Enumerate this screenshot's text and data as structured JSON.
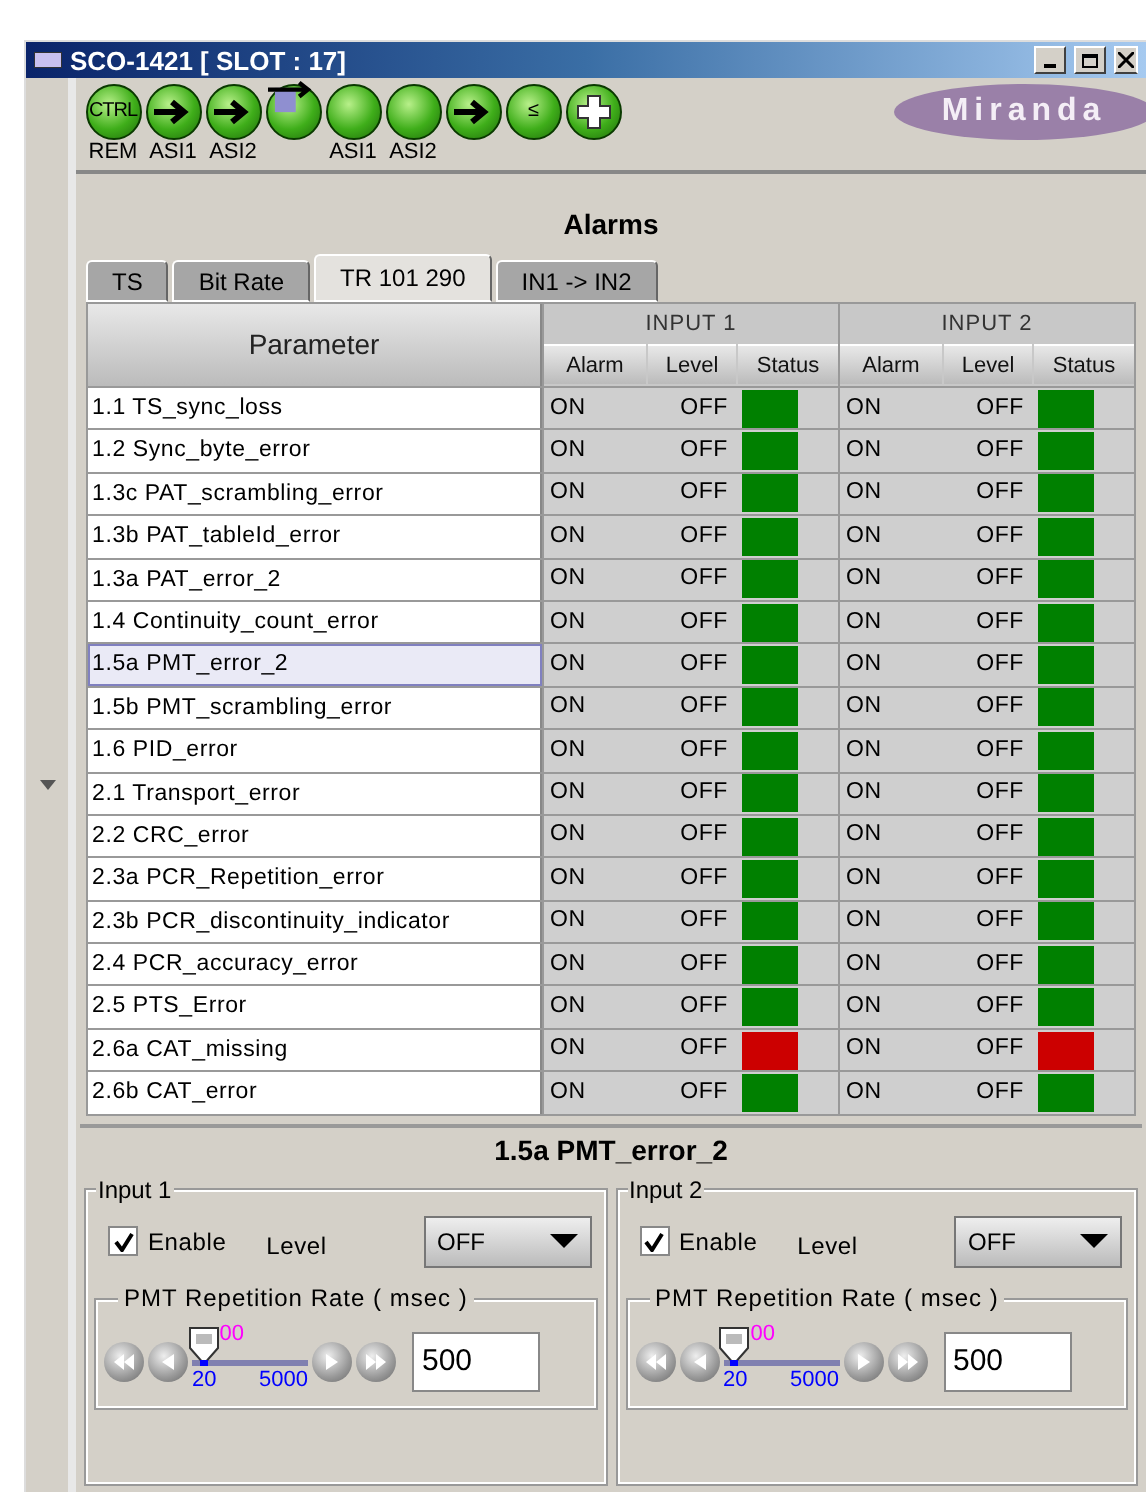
{
  "window": {
    "title": "SCO-1421 [ SLOT : 17]"
  },
  "toolbar": {
    "icons": [
      {
        "kind": "text",
        "text": "CTRL",
        "label": "REM"
      },
      {
        "kind": "arrow",
        "label": "ASI1"
      },
      {
        "kind": "arrow",
        "label": "ASI2"
      },
      {
        "kind": "switch"
      },
      {
        "kind": "plain",
        "label": "ASI1"
      },
      {
        "kind": "plain",
        "label": "ASI2"
      },
      {
        "kind": "arrow"
      },
      {
        "kind": "text",
        "text": "≤"
      },
      {
        "kind": "plus"
      }
    ],
    "logo": "Miranda"
  },
  "heading": "Alarms",
  "tabs": [
    {
      "label": "TS",
      "selected": false
    },
    {
      "label": "Bit Rate",
      "selected": false
    },
    {
      "label": "TR 101 290",
      "selected": true
    },
    {
      "label": "IN1 -> IN2",
      "selected": false
    }
  ],
  "table": {
    "parameter_header": "Parameter",
    "groups": [
      {
        "title": "INPUT 1",
        "columns": [
          "Alarm",
          "Level",
          "Status"
        ]
      },
      {
        "title": "INPUT 2",
        "columns": [
          "Alarm",
          "Level",
          "Status"
        ]
      }
    ],
    "rows": [
      {
        "parameter": "1.1 TS_sync_loss",
        "selected": false,
        "inputs": [
          {
            "alarm": "ON",
            "level": "OFF",
            "color": "#008000"
          },
          {
            "alarm": "ON",
            "level": "OFF",
            "color": "#008000"
          }
        ]
      },
      {
        "parameter": "1.2 Sync_byte_error",
        "selected": false,
        "inputs": [
          {
            "alarm": "ON",
            "level": "OFF",
            "color": "#008000"
          },
          {
            "alarm": "ON",
            "level": "OFF",
            "color": "#008000"
          }
        ]
      },
      {
        "parameter": "1.3c PAT_scrambling_error",
        "selected": false,
        "inputs": [
          {
            "alarm": "ON",
            "level": "OFF",
            "color": "#008000"
          },
          {
            "alarm": "ON",
            "level": "OFF",
            "color": "#008000"
          }
        ]
      },
      {
        "parameter": "1.3b PAT_tableId_error",
        "selected": false,
        "inputs": [
          {
            "alarm": "ON",
            "level": "OFF",
            "color": "#008000"
          },
          {
            "alarm": "ON",
            "level": "OFF",
            "color": "#008000"
          }
        ]
      },
      {
        "parameter": "1.3a PAT_error_2",
        "selected": false,
        "inputs": [
          {
            "alarm": "ON",
            "level": "OFF",
            "color": "#008000"
          },
          {
            "alarm": "ON",
            "level": "OFF",
            "color": "#008000"
          }
        ]
      },
      {
        "parameter": "1.4 Continuity_count_error",
        "selected": false,
        "inputs": [
          {
            "alarm": "ON",
            "level": "OFF",
            "color": "#008000"
          },
          {
            "alarm": "ON",
            "level": "OFF",
            "color": "#008000"
          }
        ]
      },
      {
        "parameter": "1.5a PMT_error_2",
        "selected": true,
        "inputs": [
          {
            "alarm": "ON",
            "level": "OFF",
            "color": "#008000"
          },
          {
            "alarm": "ON",
            "level": "OFF",
            "color": "#008000"
          }
        ]
      },
      {
        "parameter": "1.5b PMT_scrambling_error",
        "selected": false,
        "inputs": [
          {
            "alarm": "ON",
            "level": "OFF",
            "color": "#008000"
          },
          {
            "alarm": "ON",
            "level": "OFF",
            "color": "#008000"
          }
        ]
      },
      {
        "parameter": "1.6 PID_error",
        "selected": false,
        "inputs": [
          {
            "alarm": "ON",
            "level": "OFF",
            "color": "#008000"
          },
          {
            "alarm": "ON",
            "level": "OFF",
            "color": "#008000"
          }
        ]
      },
      {
        "parameter": "2.1 Transport_error",
        "selected": false,
        "inputs": [
          {
            "alarm": "ON",
            "level": "OFF",
            "color": "#008000"
          },
          {
            "alarm": "ON",
            "level": "OFF",
            "color": "#008000"
          }
        ]
      },
      {
        "parameter": "2.2 CRC_error",
        "selected": false,
        "inputs": [
          {
            "alarm": "ON",
            "level": "OFF",
            "color": "#008000"
          },
          {
            "alarm": "ON",
            "level": "OFF",
            "color": "#008000"
          }
        ]
      },
      {
        "parameter": "2.3a PCR_Repetition_error",
        "selected": false,
        "inputs": [
          {
            "alarm": "ON",
            "level": "OFF",
            "color": "#008000"
          },
          {
            "alarm": "ON",
            "level": "OFF",
            "color": "#008000"
          }
        ]
      },
      {
        "parameter": "2.3b PCR_discontinuity_indicator",
        "selected": false,
        "inputs": [
          {
            "alarm": "ON",
            "level": "OFF",
            "color": "#008000"
          },
          {
            "alarm": "ON",
            "level": "OFF",
            "color": "#008000"
          }
        ]
      },
      {
        "parameter": "2.4 PCR_accuracy_error",
        "selected": false,
        "inputs": [
          {
            "alarm": "ON",
            "level": "OFF",
            "color": "#008000"
          },
          {
            "alarm": "ON",
            "level": "OFF",
            "color": "#008000"
          }
        ]
      },
      {
        "parameter": "2.5 PTS_Error",
        "selected": false,
        "inputs": [
          {
            "alarm": "ON",
            "level": "OFF",
            "color": "#008000"
          },
          {
            "alarm": "ON",
            "level": "OFF",
            "color": "#008000"
          }
        ]
      },
      {
        "parameter": "2.6a CAT_missing",
        "selected": false,
        "inputs": [
          {
            "alarm": "ON",
            "level": "OFF",
            "color": "#cc0000"
          },
          {
            "alarm": "ON",
            "level": "OFF",
            "color": "#cc0000"
          }
        ]
      },
      {
        "parameter": "2.6b CAT_error",
        "selected": false,
        "inputs": [
          {
            "alarm": "ON",
            "level": "OFF",
            "color": "#008000"
          },
          {
            "alarm": "ON",
            "level": "OFF",
            "color": "#008000"
          }
        ]
      }
    ]
  },
  "detail": {
    "title": "1.5a PMT_error_2",
    "panels": [
      {
        "title": "Input 1",
        "enable": {
          "label": "Enable",
          "checked": true
        },
        "level_label": "Level",
        "level_value": "OFF",
        "rate": {
          "title": "PMT Repetition Rate ( msec )",
          "level": 0.1,
          "thumb_text": "00",
          "min": "20",
          "max": "5000",
          "value": "500"
        }
      },
      {
        "title": "Input 2",
        "enable": {
          "label": "Enable",
          "checked": true
        },
        "level_label": "Level",
        "level_value": "OFF",
        "rate": {
          "title": "PMT Repetition Rate ( msec )",
          "level": 0.1,
          "thumb_text": "00",
          "min": "20",
          "max": "5000",
          "value": "500"
        }
      }
    ]
  }
}
